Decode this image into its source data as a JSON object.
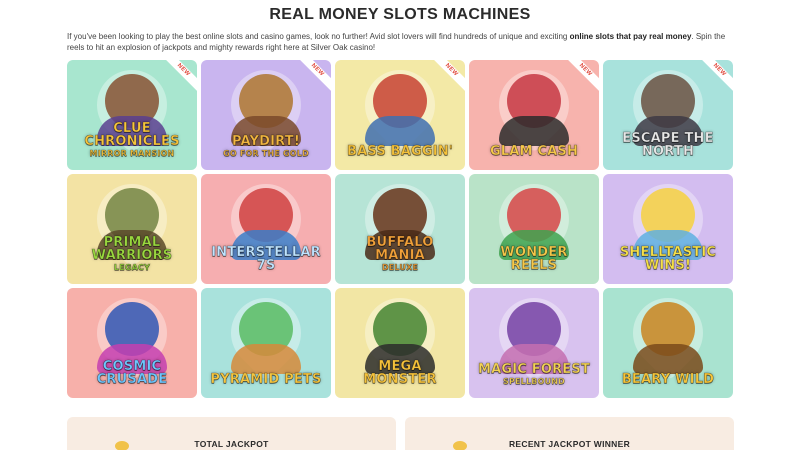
{
  "page": {
    "title": "REAL MONEY SLOTS MACHINES",
    "intro_part1": "If you've been looking to play the best online slots and casino games, look no further! Avid slot lovers will find hundreds of unique and exciting ",
    "intro_bold": "online slots that pay real money",
    "intro_part2": ". Spin the reels to hit an explosion of jackpots and mighty rewards right here at Silver Oak casino!"
  },
  "colors": {
    "new_ribbon": "#e0493c",
    "card_bg": "#f8ece2"
  },
  "games": [
    {
      "name": "Clue Chronicles",
      "sub": "Mirror Mansion",
      "new": "NEW",
      "bg": "#a8e6cf",
      "fig": "#8a5a3c",
      "fig2": "#5b3f8f",
      "logo_color": "#f6c53d"
    },
    {
      "name": "Paydirt!",
      "sub": "Go for the Gold",
      "new": "NEW",
      "bg": "#c9b5ef",
      "fig": "#b07a3a",
      "fig2": "#7a4a2a",
      "logo_color": "#f2b640"
    },
    {
      "name": "Bass Baggin'",
      "sub": "",
      "new": "NEW",
      "bg": "#f3e9a6",
      "fig": "#c94b3a",
      "fig2": "#3e6fb0",
      "logo_color": "#f5c23b"
    },
    {
      "name": "Glam Cash",
      "sub": "",
      "new": "NEW",
      "bg": "#f7b3ad",
      "fig": "#c9404a",
      "fig2": "#2b2b2b",
      "logo_color": "#f7c94a"
    },
    {
      "name": "Escape the North",
      "sub": "",
      "new": "NEW",
      "bg": "#a8e2dc",
      "fig": "#6e5a4a",
      "fig2": "#3d3a44",
      "logo_color": "#e8e8e8"
    },
    {
      "name": "Primal Warriors",
      "sub": "Legacy",
      "new": "",
      "bg": "#f3e3a4",
      "fig": "#7a8a4a",
      "fig2": "#5a4a2a",
      "logo_color": "#9ad83f"
    },
    {
      "name": "Interstellar 7s",
      "sub": "",
      "new": "",
      "bg": "#f6aeb0",
      "fig": "#d24848",
      "fig2": "#3b7ec9",
      "logo_color": "#bfe4ff"
    },
    {
      "name": "Buffalo Mania",
      "sub": "Deluxe",
      "new": "",
      "bg": "#b6e4d6",
      "fig": "#6b3d23",
      "fig2": "#4a2a18",
      "logo_color": "#f2a23a"
    },
    {
      "name": "Wonder Reels",
      "sub": "",
      "new": "",
      "bg": "#b9e3c8",
      "fig": "#d64f4f",
      "fig2": "#3fa34f",
      "logo_color": "#f5c84a"
    },
    {
      "name": "Shelltastic Wins!",
      "sub": "",
      "new": "",
      "bg": "#d3bdf0",
      "fig": "#f5d24a",
      "fig2": "#5fb0e0",
      "logo_color": "#f7e14a"
    },
    {
      "name": "Cosmic Crusade",
      "sub": "",
      "new": "",
      "bg": "#f7b0aa",
      "fig": "#3b5db5",
      "fig2": "#c43fb0",
      "logo_color": "#6fc7ff"
    },
    {
      "name": "Pyramid Pets",
      "sub": "",
      "new": "",
      "bg": "#a9e2dc",
      "fig": "#5fbf6a",
      "fig2": "#d68a3a",
      "logo_color": "#f6c640"
    },
    {
      "name": "Mega Monster",
      "sub": "",
      "new": "",
      "bg": "#f2e6a4",
      "fig": "#4f8a3a",
      "fig2": "#2b2b2b",
      "logo_color": "#f5c23b"
    },
    {
      "name": "Magic Forest",
      "sub": "Spellbound",
      "new": "",
      "bg": "#d8c2ef",
      "fig": "#7b4aa8",
      "fig2": "#c46fb0",
      "logo_color": "#f3d257"
    },
    {
      "name": "Beary Wild",
      "sub": "",
      "new": "",
      "bg": "#a9e3d0",
      "fig": "#c98a2a",
      "fig2": "#7a4a1a",
      "logo_color": "#f7c63b"
    }
  ],
  "bottom": {
    "total_jackpot_label": "TOTAL JACKPOT",
    "recent_winner_label": "RECENT JACKPOT WINNER"
  }
}
